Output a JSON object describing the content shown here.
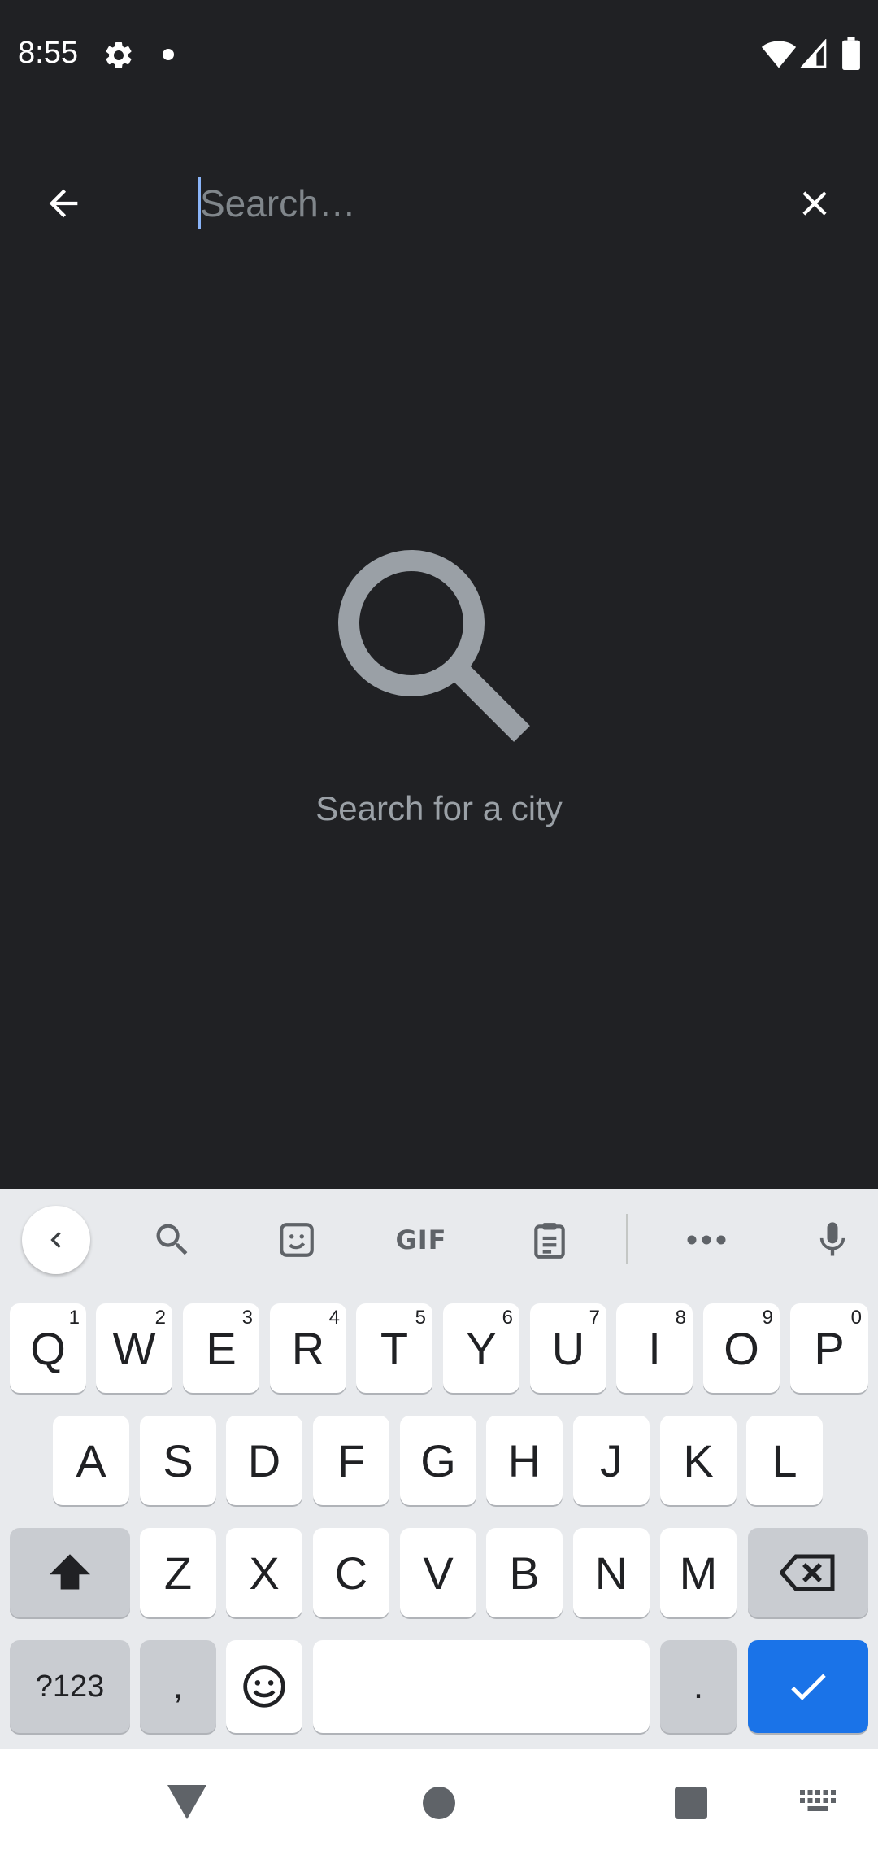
{
  "status_bar": {
    "time": "8:55",
    "icons": [
      "gear-icon",
      "notification-dot-icon",
      "wifi-icon",
      "cell-signal-icon",
      "battery-icon"
    ]
  },
  "toolbar": {
    "back_icon": "arrow-back-icon",
    "search_placeholder": "Search…",
    "search_value": "",
    "clear_icon": "close-icon"
  },
  "empty_state": {
    "icon": "search-icon",
    "text": "Search for a city"
  },
  "keyboard": {
    "toolbar_icons": [
      "collapse-icon",
      "search-icon",
      "sticker-icon",
      "gif-icon",
      "clipboard-icon",
      "more-icon",
      "mic-icon"
    ],
    "gif_label": "GIF",
    "row1": [
      {
        "label": "Q",
        "hint": "1"
      },
      {
        "label": "W",
        "hint": "2"
      },
      {
        "label": "E",
        "hint": "3"
      },
      {
        "label": "R",
        "hint": "4"
      },
      {
        "label": "T",
        "hint": "5"
      },
      {
        "label": "Y",
        "hint": "6"
      },
      {
        "label": "U",
        "hint": "7"
      },
      {
        "label": "I",
        "hint": "8"
      },
      {
        "label": "O",
        "hint": "9"
      },
      {
        "label": "P",
        "hint": "0"
      }
    ],
    "row2": [
      "A",
      "S",
      "D",
      "F",
      "G",
      "H",
      "J",
      "K",
      "L"
    ],
    "row3": [
      "Z",
      "X",
      "C",
      "V",
      "B",
      "N",
      "M"
    ],
    "symbols_label": "?123",
    "comma_label": ",",
    "period_label": ".",
    "space_label": ""
  },
  "nav_bar": {
    "icons": [
      "nav-back-icon",
      "nav-home-icon",
      "nav-recents-icon",
      "keyboard-switch-icon"
    ]
  },
  "colors": {
    "background": "#202124",
    "keyboard_bg": "#e8eaed",
    "accent": "#1a73e8",
    "muted_text": "#9aa0a6"
  }
}
